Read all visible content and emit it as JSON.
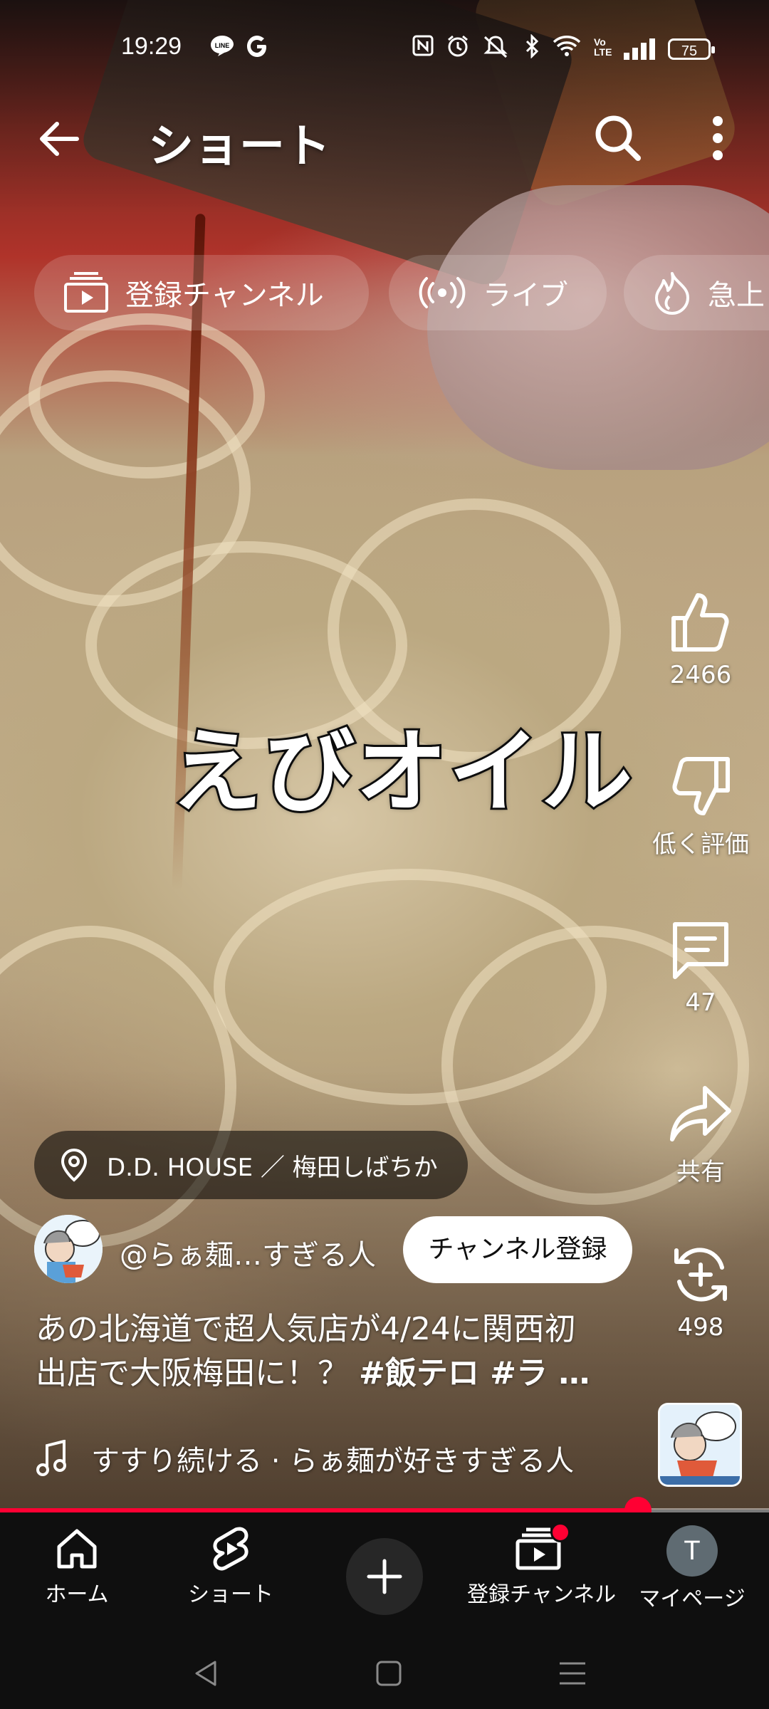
{
  "status_bar": {
    "time": "19:29",
    "left_icons": [
      "line-icon",
      "google-icon"
    ],
    "right_icons": [
      "nfc-icon",
      "alarm-icon",
      "mute-icon",
      "bluetooth-icon",
      "wifi-icon",
      "volte-icon",
      "signal-icon",
      "battery-icon"
    ],
    "volte_label": "Vo LTE",
    "battery": "75"
  },
  "top_bar": {
    "title": "ショート",
    "icons": [
      "back-arrow-icon",
      "search-icon",
      "more-vert-icon"
    ]
  },
  "chips": [
    {
      "label": "登録チャンネル",
      "icon": "subscriptions-icon"
    },
    {
      "label": "ライブ",
      "icon": "live-icon"
    },
    {
      "label": "急上",
      "icon": "trending-flame-icon"
    }
  ],
  "video": {
    "overlay_text": "えびオイル",
    "progress_fraction": 0.83
  },
  "actions": {
    "like": {
      "label": "2466",
      "icon": "thumb-up-icon"
    },
    "dislike": {
      "label": "低く評価",
      "icon": "thumb-down-icon"
    },
    "comments": {
      "label": "47",
      "icon": "comment-icon"
    },
    "share": {
      "label": "共有",
      "icon": "share-icon"
    },
    "remix": {
      "label": "498",
      "icon": "remix-icon"
    }
  },
  "meta": {
    "location": "D.D. HOUSE ／ 梅田しばちか",
    "channel_handle": "@らぁ麺…すぎる人",
    "subscribe_label": "チャンネル登録",
    "description_line1": "あの北海道で超人気店が4/24に関西初",
    "description_line2_plain": "出店で大阪梅田に！？ ",
    "description_line2_tags": "#飯テロ #ラ …",
    "music": "すすり続ける · らぁ麺が好きすぎる人"
  },
  "nav": {
    "home": "ホーム",
    "shorts": "ショート",
    "subscriptions": "登録チャンネル",
    "me": "マイページ",
    "me_initial": "T"
  },
  "colors": {
    "accent": "#ff0033",
    "nav_bg": "#0f0f0f",
    "chip_bg": "rgba(255,255,255,0.16)"
  }
}
